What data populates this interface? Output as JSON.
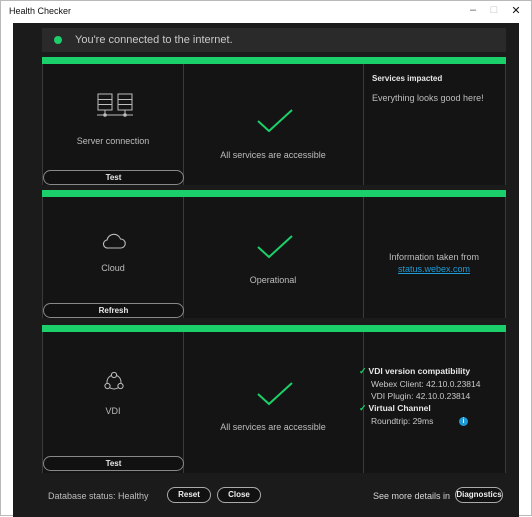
{
  "window": {
    "title": "Health Checker",
    "minimize": "–",
    "maximize": "□",
    "close": "✕"
  },
  "banner": {
    "text": "You're connected to the internet.",
    "status_color": "#1bd06a"
  },
  "panels": {
    "server": {
      "icon": "server-icon",
      "label": "Server connection",
      "button": "Test",
      "status": "All services are accessible",
      "impacted_title": "Services impacted",
      "impacted_text": "Everything looks good here!"
    },
    "cloud": {
      "icon": "cloud-icon",
      "label": "Cloud",
      "button": "Refresh",
      "status": "Operational",
      "info_text": "Information taken from",
      "info_link": "status.webex.com"
    },
    "vdi": {
      "icon": "vdi-icon",
      "label": "VDI",
      "button": "Test",
      "status": "All services are accessible",
      "compat_title": "VDI version compatibility",
      "webex_client": "Webex Client: 42.10.0.23814",
      "vdi_plugin": "VDI Plugin: 42.10.0.23814",
      "channel_title": "Virtual Channel",
      "roundtrip": "Roundtrip: 29ms",
      "info_icon": "i"
    }
  },
  "footer": {
    "db_status": "Database status: Healthy",
    "reset": "Reset",
    "close": "Close",
    "see_more": "See more details in",
    "diagnostics": "Diagnostics"
  },
  "colors": {
    "accent": "#1bd06a",
    "link": "#1d9bd6",
    "background": "#1b1b1b"
  }
}
